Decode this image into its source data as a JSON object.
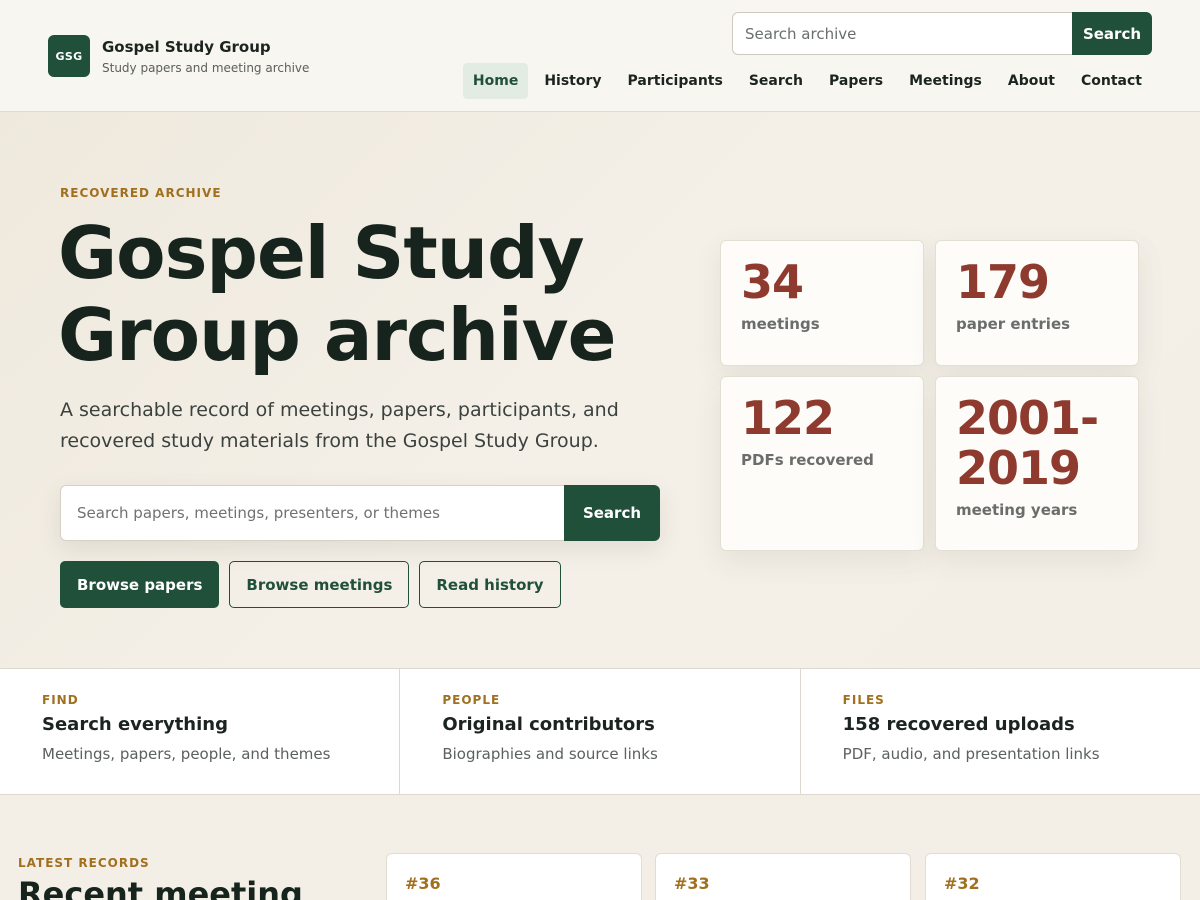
{
  "brand": {
    "logo": "GSG",
    "name": "Gospel Study Group",
    "tagline": "Study papers and meeting archive"
  },
  "header_search": {
    "placeholder": "Search archive",
    "button": "Search"
  },
  "nav": {
    "items": [
      {
        "label": "Home",
        "active": true
      },
      {
        "label": "History"
      },
      {
        "label": "Participants"
      },
      {
        "label": "Search"
      },
      {
        "label": "Papers"
      },
      {
        "label": "Meetings"
      },
      {
        "label": "About"
      },
      {
        "label": "Contact"
      }
    ]
  },
  "hero": {
    "eyebrow": "RECOVERED ARCHIVE",
    "title": "Gospel Study Group archive",
    "subtitle": "A searchable record of meetings, papers, participants, and recovered study materials from the Gospel Study Group.",
    "search_placeholder": "Search papers, meetings, presenters, or themes",
    "search_button": "Search",
    "actions": [
      "Browse papers",
      "Browse meetings",
      "Read history"
    ]
  },
  "stats": [
    {
      "value": "34",
      "label": "meetings"
    },
    {
      "value": "179",
      "label": "paper entries"
    },
    {
      "value": "122",
      "label": "PDFs recovered"
    },
    {
      "value": "2001-2019",
      "label": "meeting years"
    }
  ],
  "features": [
    {
      "eyebrow": "FIND",
      "title": "Search everything",
      "desc": "Meetings, papers, people, and themes"
    },
    {
      "eyebrow": "PEOPLE",
      "title": "Original contributors",
      "desc": "Biographies and source links"
    },
    {
      "eyebrow": "FILES",
      "title": "158 recovered uploads",
      "desc": "PDF, audio, and presentation links"
    }
  ],
  "latest": {
    "eyebrow": "LATEST RECORDS",
    "title": "Recent meeting",
    "records": [
      "#36",
      "#33",
      "#32"
    ]
  },
  "colors": {
    "brand_green": "#21503a",
    "accent_red": "#8e3a2f",
    "eyebrow_gold": "#a1701f"
  }
}
